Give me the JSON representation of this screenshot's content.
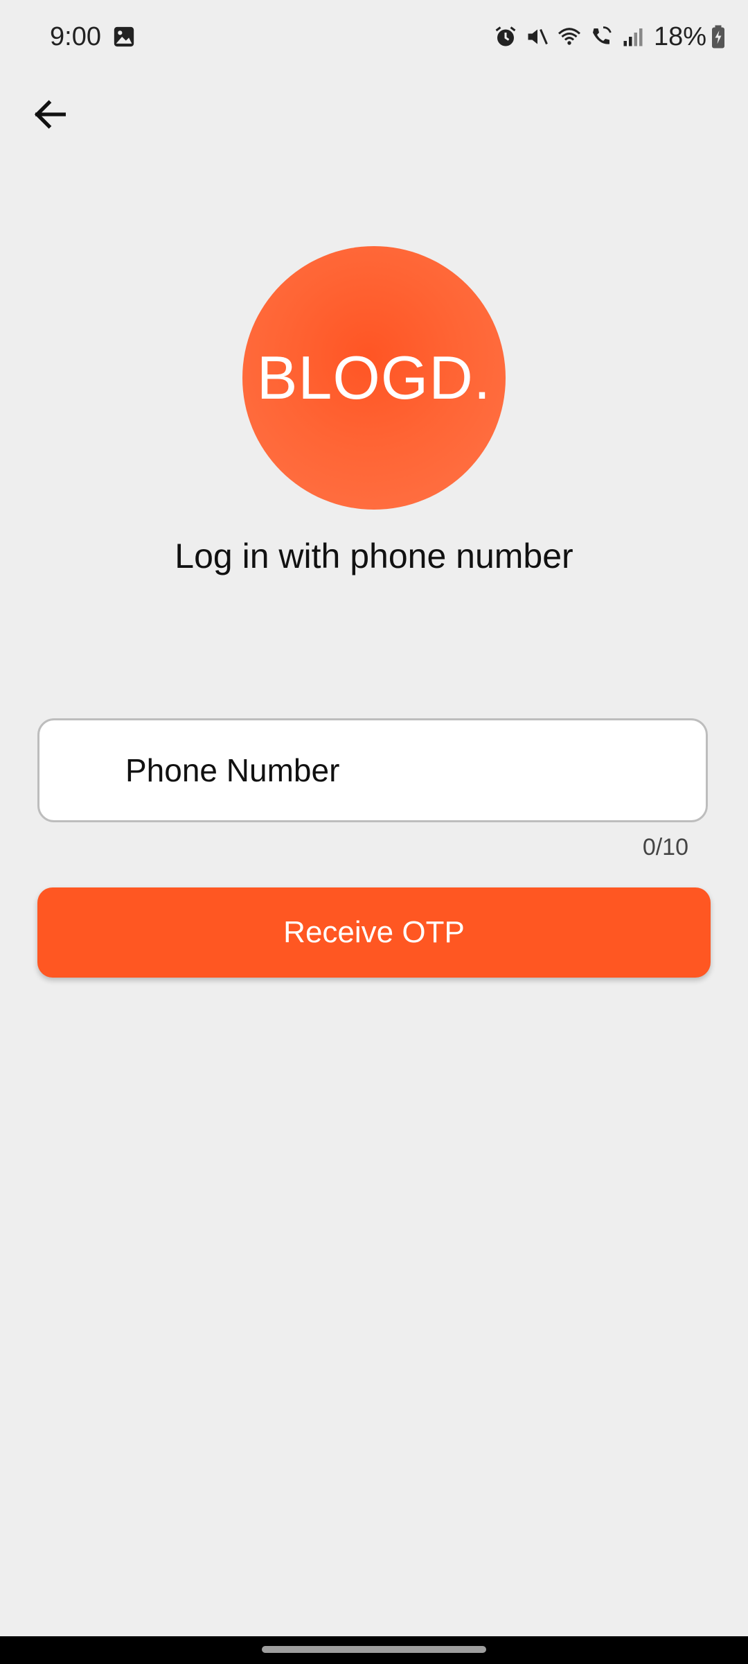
{
  "status_bar": {
    "time": "9:00",
    "battery": "18%",
    "icons": [
      "gallery-icon",
      "alarm-icon",
      "mute-icon",
      "wifi-icon",
      "wifi-call-icon",
      "signal-icon",
      "battery-charging-icon"
    ]
  },
  "header": {
    "back_icon": "arrow-left-icon"
  },
  "logo": {
    "text": "BLOGD."
  },
  "login": {
    "subtitle": "Log in with phone number",
    "phone_placeholder": "Phone Number",
    "phone_value": "",
    "counter": "0/10",
    "button_label": "Receive OTP"
  },
  "colors": {
    "accent": "#ff5722",
    "background": "#eeeeee"
  }
}
